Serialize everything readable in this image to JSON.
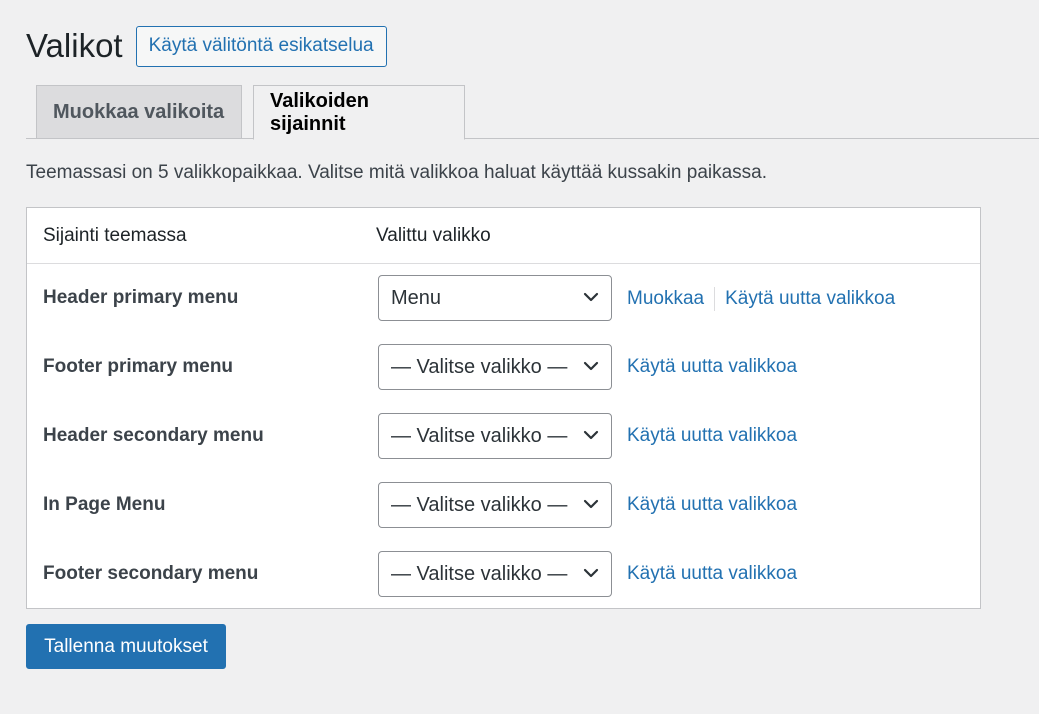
{
  "page": {
    "title": "Valikot",
    "preview_button": "Käytä välitöntä esikatselua",
    "description": "Teemassasi on 5 valikkopaikkaa. Valitse mitä valikkoa haluat käyttää kussakin paikassa.",
    "save_button": "Tallenna muutokset"
  },
  "tabs": [
    {
      "label": "Muokkaa valikoita",
      "active": false
    },
    {
      "label": "Valikoiden sijainnit",
      "active": true
    }
  ],
  "table": {
    "columns": [
      "Sijainti teemassa",
      "Valittu valikko"
    ],
    "rows": [
      {
        "location": "Header primary menu",
        "selected": "Menu",
        "edit_link": "Muokkaa",
        "new_link": "Käytä uutta valikkoa"
      },
      {
        "location": "Footer primary menu",
        "selected": "— Valitse valikko —",
        "new_link": "Käytä uutta valikkoa"
      },
      {
        "location": "Header secondary menu",
        "selected": "— Valitse valikko —",
        "new_link": "Käytä uutta valikkoa"
      },
      {
        "location": "In Page Menu",
        "selected": "— Valitse valikko —",
        "new_link": "Käytä uutta valikkoa"
      },
      {
        "location": "Footer secondary menu",
        "selected": "— Valitse valikko —",
        "new_link": "Käytä uutta valikkoa"
      }
    ]
  },
  "icons": {
    "select_arrow": "chevron-down-icon"
  },
  "colors": {
    "accent": "#2271b1",
    "background": "#f0f0f1",
    "panel": "#ffffff",
    "border": "#c3c4c7"
  }
}
